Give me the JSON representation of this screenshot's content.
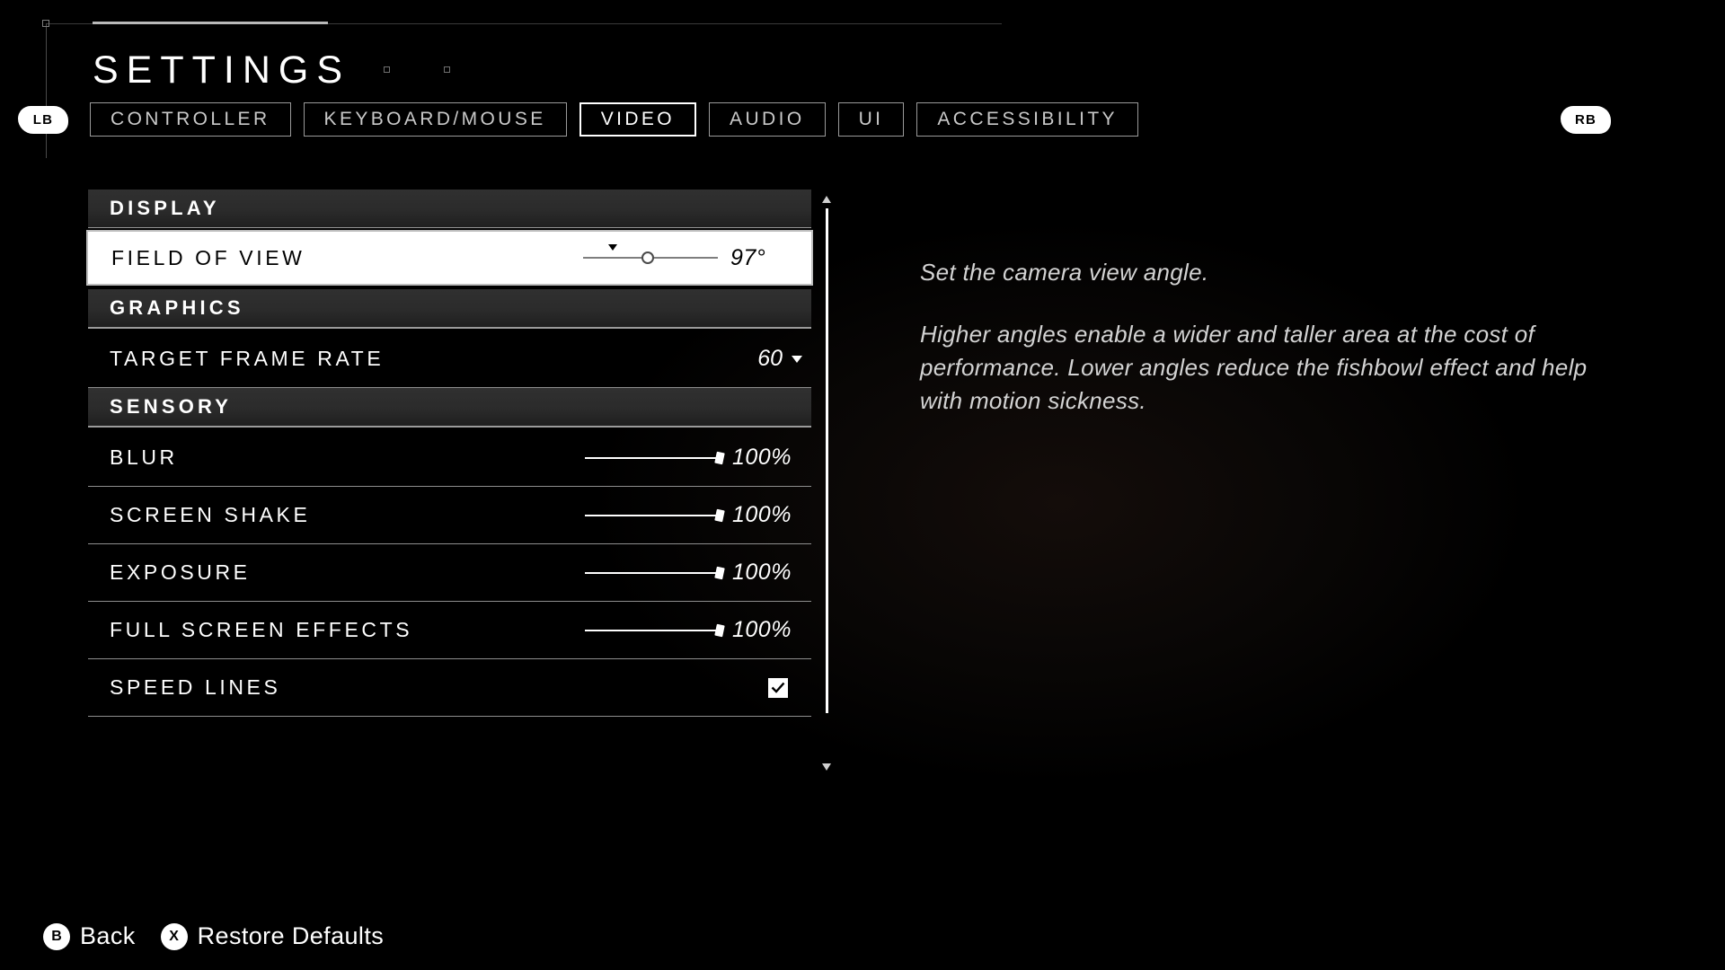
{
  "header": {
    "title": "SETTINGS",
    "bumper_left": "LB",
    "bumper_right": "RB",
    "tabs": [
      {
        "label": "CONTROLLER",
        "active": false
      },
      {
        "label": "KEYBOARD/MOUSE",
        "active": false
      },
      {
        "label": "VIDEO",
        "active": true
      },
      {
        "label": "AUDIO",
        "active": false
      },
      {
        "label": "UI",
        "active": false
      },
      {
        "label": "ACCESSIBILITY",
        "active": false
      }
    ]
  },
  "settings": {
    "sections": [
      {
        "name": "DISPLAY",
        "items": [
          {
            "label": "FIELD OF VIEW",
            "type": "slider",
            "value": "97°",
            "fill_percent": 48,
            "default_percent": 22,
            "selected": true
          }
        ]
      },
      {
        "name": "GRAPHICS",
        "items": [
          {
            "label": "TARGET FRAME RATE",
            "type": "dropdown",
            "value": "60",
            "selected": false
          }
        ]
      },
      {
        "name": "SENSORY",
        "items": [
          {
            "label": "BLUR",
            "type": "slider",
            "value": "100%",
            "fill_percent": 100,
            "selected": false
          },
          {
            "label": "SCREEN SHAKE",
            "type": "slider",
            "value": "100%",
            "fill_percent": 100,
            "selected": false
          },
          {
            "label": "EXPOSURE",
            "type": "slider",
            "value": "100%",
            "fill_percent": 100,
            "selected": false
          },
          {
            "label": "FULL SCREEN EFFECTS",
            "type": "slider",
            "value": "100%",
            "fill_percent": 100,
            "selected": false
          },
          {
            "label": "SPEED LINES",
            "type": "checkbox",
            "checked": true,
            "selected": false
          }
        ]
      }
    ]
  },
  "description": {
    "paragraphs": [
      "Set the camera view angle.",
      "Higher angles enable a wider and taller area at the cost of performance. Lower angles reduce the fishbowl effect and help with motion sickness."
    ]
  },
  "footer": {
    "prompts": [
      {
        "glyph": "B",
        "label": "Back"
      },
      {
        "glyph": "X",
        "label": "Restore Defaults"
      }
    ]
  },
  "colors": {
    "accent": "#ffffff",
    "background": "#000000",
    "section_header": "#2b2b2b",
    "muted_text": "#d3d3d3"
  }
}
